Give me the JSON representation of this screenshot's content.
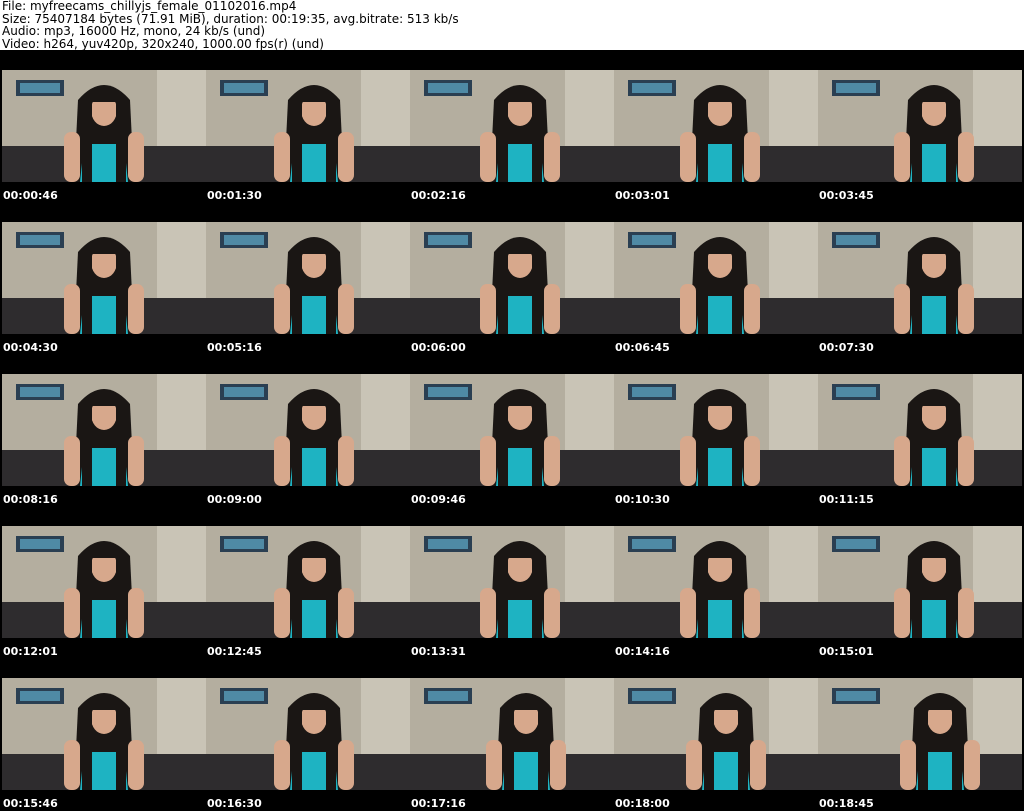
{
  "header": {
    "file_line": "File: myfreecams_chillyjs_female_01102016.mp4",
    "size_line": "Size: 75407184 bytes (71.91 MiB), duration: 00:19:35, avg.bitrate: 513 kb/s",
    "audio_line": "Audio: mp3, 16000 Hz, mono, 24 kb/s (und)",
    "video_line": "Video: h264, yuv420p, 320x240, 1000.00 fps(r) (und)"
  },
  "thumbnails": [
    {
      "timestamp": "00:00:46"
    },
    {
      "timestamp": "00:01:30"
    },
    {
      "timestamp": "00:02:16"
    },
    {
      "timestamp": "00:03:01"
    },
    {
      "timestamp": "00:03:45"
    },
    {
      "timestamp": "00:04:30"
    },
    {
      "timestamp": "00:05:16"
    },
    {
      "timestamp": "00:06:00"
    },
    {
      "timestamp": "00:06:45"
    },
    {
      "timestamp": "00:07:30"
    },
    {
      "timestamp": "00:08:16"
    },
    {
      "timestamp": "00:09:00"
    },
    {
      "timestamp": "00:09:46"
    },
    {
      "timestamp": "00:10:30"
    },
    {
      "timestamp": "00:11:15"
    },
    {
      "timestamp": "00:12:01"
    },
    {
      "timestamp": "00:12:45"
    },
    {
      "timestamp": "00:13:31"
    },
    {
      "timestamp": "00:14:16"
    },
    {
      "timestamp": "00:15:01"
    },
    {
      "timestamp": "00:15:46"
    },
    {
      "timestamp": "00:16:30"
    },
    {
      "timestamp": "00:17:16"
    },
    {
      "timestamp": "00:18:00"
    },
    {
      "timestamp": "00:18:45"
    }
  ],
  "colors": {
    "sheet_background": "#000000",
    "wall": "#b4ae9f",
    "carpet": "#2e2c2e",
    "hair": "#1a1614",
    "skin": "#d7a88c",
    "top": "#1eb3c2",
    "timestamp_text": "#ffffff"
  }
}
